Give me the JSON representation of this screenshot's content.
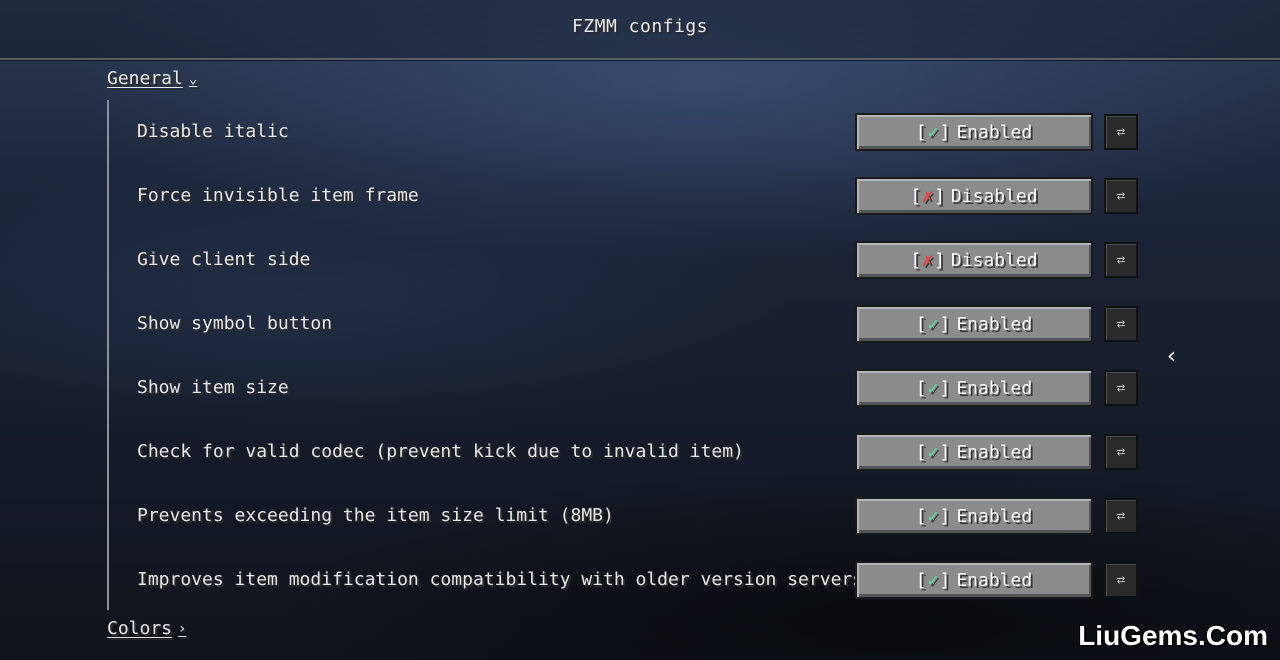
{
  "window": {
    "title": "FZMM configs"
  },
  "sections": {
    "general": {
      "label": "General",
      "arrow": "⌄"
    },
    "colors": {
      "label": "Colors",
      "arrow": "›"
    }
  },
  "options": [
    {
      "label": "Disable italic",
      "state": "Enabled"
    },
    {
      "label": "Force invisible item frame",
      "state": "Disabled"
    },
    {
      "label": "Give client side",
      "state": "Disabled"
    },
    {
      "label": "Show symbol button",
      "state": "Enabled"
    },
    {
      "label": "Show item size",
      "state": "Enabled"
    },
    {
      "label": "Check for valid codec (prevent kick due to invalid item)",
      "state": "Enabled"
    },
    {
      "label": "Prevents exceeding the item size limit (8MB)",
      "state": "Enabled"
    },
    {
      "label": "Improves item modification compatibility with older version servers",
      "state": "Enabled"
    }
  ],
  "glyphs": {
    "check": "✓",
    "cross": "✗",
    "bracket_open": "[",
    "bracket_close": "]",
    "reset": "⇄",
    "side_chevron": "‹"
  },
  "icons": {
    "reset": "reset-icon",
    "check": "check-icon",
    "cross": "cross-icon",
    "side_chevron": "chevron-left-icon"
  },
  "colors": {
    "enabled_mark": "#55e0a0",
    "disabled_mark": "#ff3a3a",
    "button_face": "#8b8b8b"
  },
  "watermark": "LiuGems.Com"
}
